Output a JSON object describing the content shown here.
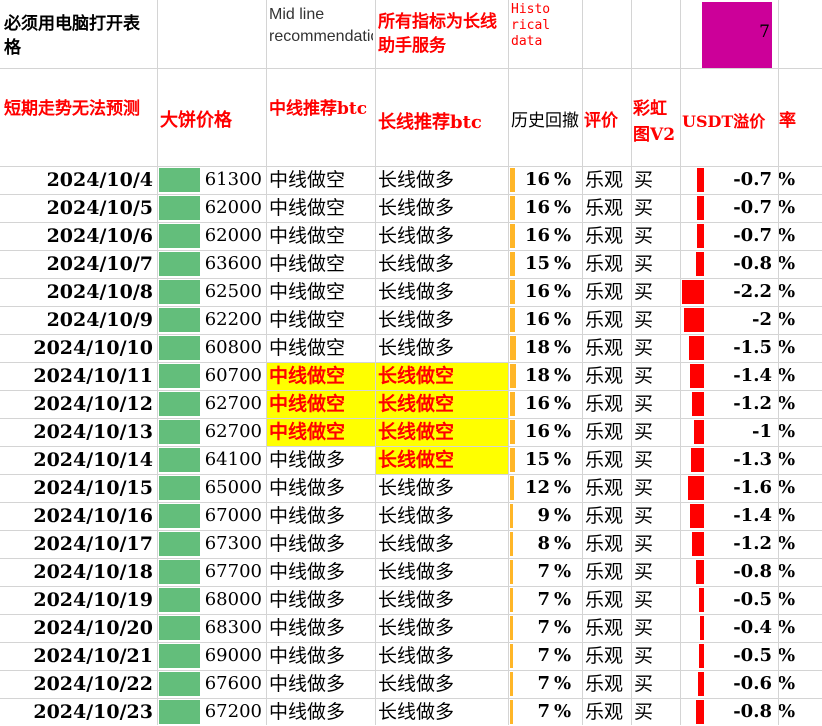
{
  "header": {
    "note": "必须用电脑打开表格",
    "mid_en": "Mid line recommendation",
    "long_note": "所有指标为长线助手服务",
    "hist_en": "Historical data",
    "top_value": "7",
    "col_trend": "短期走势无法预测",
    "col_price": "大饼价格",
    "col_mid": "中线推荐btc",
    "col_long": "长线推荐btc",
    "col_hist": "历史回撤",
    "col_eval": "评价",
    "col_rainbow": "彩虹图V2",
    "col_usdt": "USDT溢价",
    "col_rate": "率"
  },
  "colors": {
    "green_bar": "#63be7b",
    "orange_bar": "#ffb628",
    "red_bar": "#ff0000",
    "highlight": "#ffff00",
    "magenta": "#cc0099"
  },
  "pct_symbol": "%",
  "rows": [
    {
      "date": "2024/10/4",
      "price": "61300",
      "price_level": 0.6,
      "mid": "中线做空",
      "long": "长线做多",
      "hist": "16",
      "hist_level": 0.9,
      "eval": "乐观",
      "rainbow": "买",
      "usdt": "-0.7",
      "usdt_level": 0.32,
      "mid_hl": false,
      "long_hl": false
    },
    {
      "date": "2024/10/5",
      "price": "62000",
      "price_level": 0.6,
      "mid": "中线做空",
      "long": "长线做多",
      "hist": "16",
      "hist_level": 0.9,
      "eval": "乐观",
      "rainbow": "买",
      "usdt": "-0.7",
      "usdt_level": 0.32,
      "mid_hl": false,
      "long_hl": false
    },
    {
      "date": "2024/10/6",
      "price": "62000",
      "price_level": 0.6,
      "mid": "中线做空",
      "long": "长线做多",
      "hist": "16",
      "hist_level": 0.9,
      "eval": "乐观",
      "rainbow": "买",
      "usdt": "-0.7",
      "usdt_level": 0.32,
      "mid_hl": false,
      "long_hl": false
    },
    {
      "date": "2024/10/7",
      "price": "63600",
      "price_level": 0.6,
      "mid": "中线做空",
      "long": "长线做多",
      "hist": "15",
      "hist_level": 0.85,
      "eval": "乐观",
      "rainbow": "买",
      "usdt": "-0.8",
      "usdt_level": 0.36,
      "mid_hl": false,
      "long_hl": false
    },
    {
      "date": "2024/10/8",
      "price": "62500",
      "price_level": 0.6,
      "mid": "中线做空",
      "long": "长线做多",
      "hist": "16",
      "hist_level": 0.9,
      "eval": "乐观",
      "rainbow": "买",
      "usdt": "-2.2",
      "usdt_level": 1.0,
      "mid_hl": false,
      "long_hl": false
    },
    {
      "date": "2024/10/9",
      "price": "62200",
      "price_level": 0.6,
      "mid": "中线做空",
      "long": "长线做多",
      "hist": "16",
      "hist_level": 0.9,
      "eval": "乐观",
      "rainbow": "买",
      "usdt": "-2",
      "usdt_level": 0.91,
      "mid_hl": false,
      "long_hl": false
    },
    {
      "date": "2024/10/10",
      "price": "60800",
      "price_level": 0.6,
      "mid": "中线做空",
      "long": "长线做多",
      "hist": "18",
      "hist_level": 1.0,
      "eval": "乐观",
      "rainbow": "买",
      "usdt": "-1.5",
      "usdt_level": 0.68,
      "mid_hl": false,
      "long_hl": false
    },
    {
      "date": "2024/10/11",
      "price": "60700",
      "price_level": 0.6,
      "mid": "中线做空",
      "long": "长线做空",
      "hist": "18",
      "hist_level": 1.0,
      "eval": "乐观",
      "rainbow": "买",
      "usdt": "-1.4",
      "usdt_level": 0.64,
      "mid_hl": true,
      "long_hl": true
    },
    {
      "date": "2024/10/12",
      "price": "62700",
      "price_level": 0.6,
      "mid": "中线做空",
      "long": "长线做空",
      "hist": "16",
      "hist_level": 0.9,
      "eval": "乐观",
      "rainbow": "买",
      "usdt": "-1.2",
      "usdt_level": 0.55,
      "mid_hl": true,
      "long_hl": true
    },
    {
      "date": "2024/10/13",
      "price": "62700",
      "price_level": 0.6,
      "mid": "中线做空",
      "long": "长线做空",
      "hist": "16",
      "hist_level": 0.9,
      "eval": "乐观",
      "rainbow": "买",
      "usdt": "-1",
      "usdt_level": 0.45,
      "mid_hl": true,
      "long_hl": true
    },
    {
      "date": "2024/10/14",
      "price": "64100",
      "price_level": 0.6,
      "mid": "中线做多",
      "long": "长线做空",
      "hist": "15",
      "hist_level": 0.85,
      "eval": "乐观",
      "rainbow": "买",
      "usdt": "-1.3",
      "usdt_level": 0.59,
      "mid_hl": false,
      "long_hl": true
    },
    {
      "date": "2024/10/15",
      "price": "65000",
      "price_level": 0.6,
      "mid": "中线做多",
      "long": "长线做多",
      "hist": "12",
      "hist_level": 0.68,
      "eval": "乐观",
      "rainbow": "买",
      "usdt": "-1.6",
      "usdt_level": 0.73,
      "mid_hl": false,
      "long_hl": false
    },
    {
      "date": "2024/10/16",
      "price": "67000",
      "price_level": 0.6,
      "mid": "中线做多",
      "long": "长线做多",
      "hist": "9",
      "hist_level": 0.5,
      "eval": "乐观",
      "rainbow": "买",
      "usdt": "-1.4",
      "usdt_level": 0.64,
      "mid_hl": false,
      "long_hl": false
    },
    {
      "date": "2024/10/17",
      "price": "67300",
      "price_level": 0.6,
      "mid": "中线做多",
      "long": "长线做多",
      "hist": "8",
      "hist_level": 0.45,
      "eval": "乐观",
      "rainbow": "买",
      "usdt": "-1.2",
      "usdt_level": 0.55,
      "mid_hl": false,
      "long_hl": false
    },
    {
      "date": "2024/10/18",
      "price": "67700",
      "price_level": 0.6,
      "mid": "中线做多",
      "long": "长线做多",
      "hist": "7",
      "hist_level": 0.4,
      "eval": "乐观",
      "rainbow": "买",
      "usdt": "-0.8",
      "usdt_level": 0.36,
      "mid_hl": false,
      "long_hl": false
    },
    {
      "date": "2024/10/19",
      "price": "68000",
      "price_level": 0.6,
      "mid": "中线做多",
      "long": "长线做多",
      "hist": "7",
      "hist_level": 0.4,
      "eval": "乐观",
      "rainbow": "买",
      "usdt": "-0.5",
      "usdt_level": 0.23,
      "mid_hl": false,
      "long_hl": false
    },
    {
      "date": "2024/10/20",
      "price": "68300",
      "price_level": 0.6,
      "mid": "中线做多",
      "long": "长线做多",
      "hist": "7",
      "hist_level": 0.4,
      "eval": "乐观",
      "rainbow": "买",
      "usdt": "-0.4",
      "usdt_level": 0.18,
      "mid_hl": false,
      "long_hl": false
    },
    {
      "date": "2024/10/21",
      "price": "69000",
      "price_level": 0.6,
      "mid": "中线做多",
      "long": "长线做多",
      "hist": "7",
      "hist_level": 0.4,
      "eval": "乐观",
      "rainbow": "买",
      "usdt": "-0.5",
      "usdt_level": 0.23,
      "mid_hl": false,
      "long_hl": false
    },
    {
      "date": "2024/10/22",
      "price": "67600",
      "price_level": 0.6,
      "mid": "中线做多",
      "long": "长线做多",
      "hist": "7",
      "hist_level": 0.4,
      "eval": "乐观",
      "rainbow": "买",
      "usdt": "-0.6",
      "usdt_level": 0.27,
      "mid_hl": false,
      "long_hl": false
    },
    {
      "date": "2024/10/23",
      "price": "67200",
      "price_level": 0.6,
      "mid": "中线做多",
      "long": "长线做多",
      "hist": "7",
      "hist_level": 0.4,
      "eval": "乐观",
      "rainbow": "买",
      "usdt": "-0.8",
      "usdt_level": 0.36,
      "mid_hl": false,
      "long_hl": false
    }
  ]
}
